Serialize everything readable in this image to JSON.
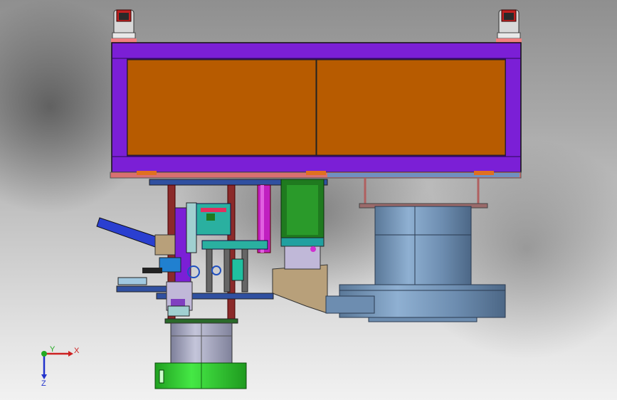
{
  "viewport": {
    "background_top": "#8f8f8f",
    "background_bottom": "#f1f1f1"
  },
  "colors": {
    "frame_purple": "#7b1fd6",
    "panel_orange": "#b75b00",
    "cylinder_steel": "#6f8fb3",
    "rod_maroon": "#8b2a2a",
    "magenta": "#c020c0",
    "green_block": "#1f7a1f",
    "bright_green": "#33dd33",
    "tan_plate": "#b8a07a",
    "blue_chute": "#2a3fd0",
    "teal": "#2ab0a0"
  },
  "triad": {
    "x_label": "X",
    "y_label": "Y",
    "z_label": "Z",
    "x_color": "#cc2222",
    "y_color": "#22aa22",
    "z_color": "#2233cc"
  }
}
